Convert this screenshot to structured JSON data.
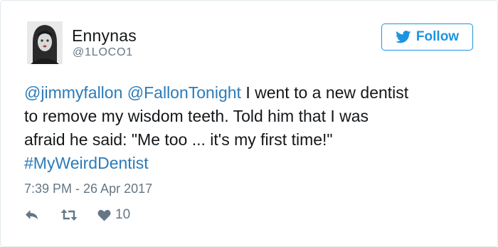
{
  "author": {
    "display_name": "Ennynas",
    "handle": "@1LOCO1",
    "avatar_icon": "profile-photo"
  },
  "follow_button": {
    "label": "Follow",
    "icon": "twitter-bird-icon",
    "color": "#1b95e0"
  },
  "tweet": {
    "mention_1": "@jimmyfallon",
    "mention_2": "@FallonTonight",
    "line1_text": " I went to a new dentist",
    "line2_text": "to remove my wisdom teeth. Told him that I was",
    "line3_text": "afraid he said: \"Me too ... it's my first time!\"",
    "hashtag": "#MyWeirdDentist",
    "link_color": "#2b7bb9"
  },
  "timestamp": "7:39 PM - 26 Apr 2017",
  "actions": {
    "reply_icon": "reply-icon",
    "retweet_icon": "retweet-icon",
    "like_icon": "heart-icon",
    "like_count": "10"
  }
}
